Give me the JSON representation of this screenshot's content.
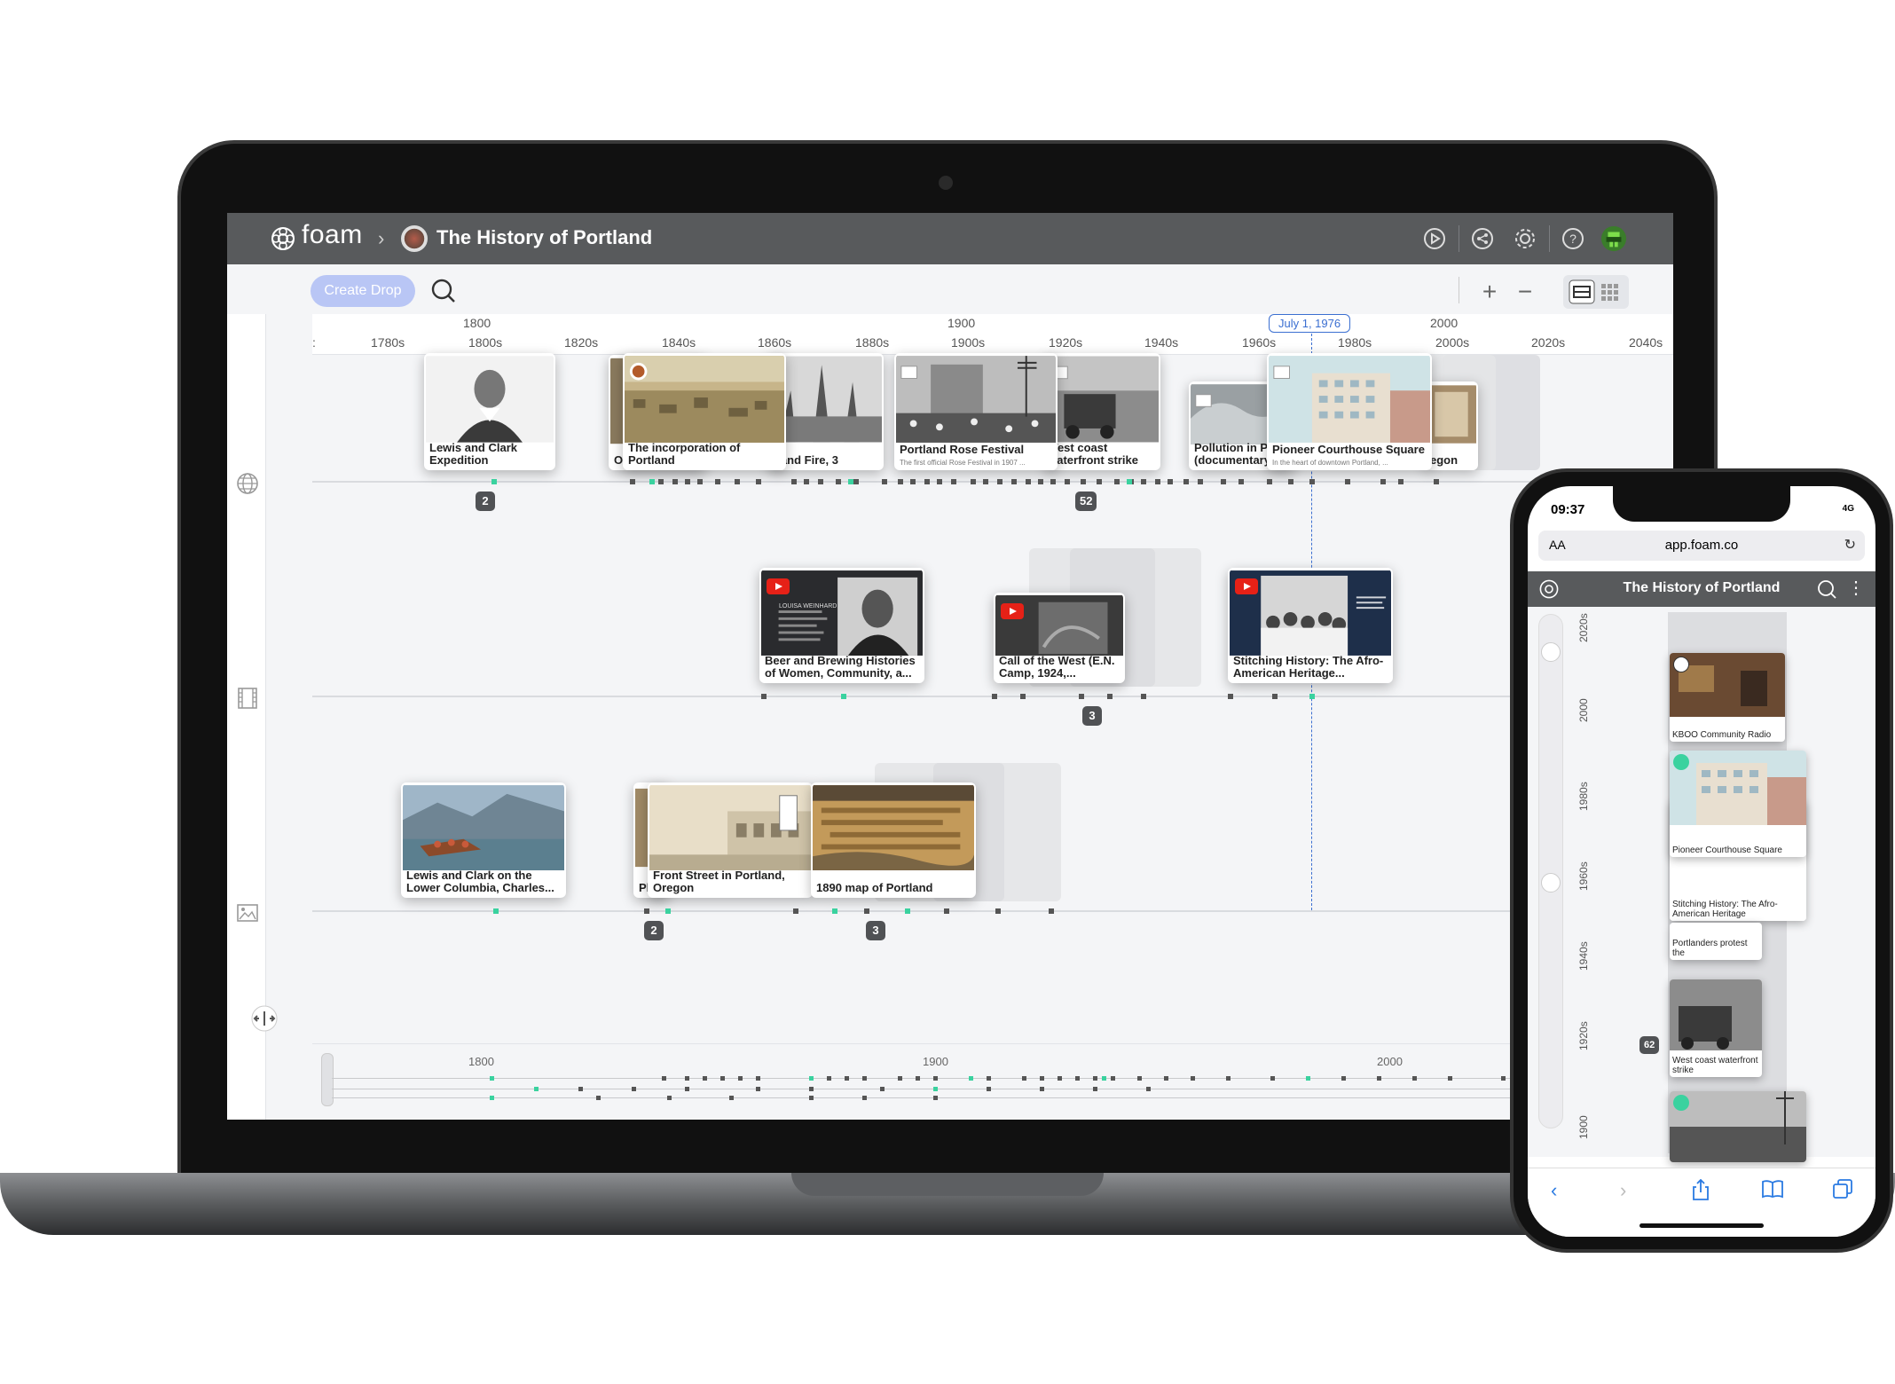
{
  "app": {
    "logo": "foam",
    "breadcrumb_sep": "›",
    "project_title": "The History of Portland",
    "create_drop": "Create Drop",
    "zoom_in": "+",
    "zoom_out": "−"
  },
  "axis": {
    "major": [
      "1800",
      "1900",
      "2000"
    ],
    "minor": [
      ":",
      "1780s",
      "1800s",
      "1820s",
      "1840s",
      "1860s",
      "1880s",
      "1900s",
      "1920s",
      "1940s",
      "1960s",
      "1980s",
      "2000s",
      "2020s",
      "2040s"
    ],
    "selected_date": "July 1, 1976"
  },
  "lanes": {
    "web": {
      "icon": "globe-icon",
      "count": "2",
      "count2": "52",
      "cards": [
        {
          "title": "Lewis and Clark Expedition"
        },
        {
          "title": "The incorporation of Portland"
        },
        {
          "title": "tland Fire, 3"
        },
        {
          "title": "O O"
        },
        {
          "title": "Portland Rose Festival",
          "sub": "The first official Rose Festival in 1907 ..."
        },
        {
          "title": "Vest coast vaterfront strike"
        },
        {
          "title": "Pollution in Pa (documentary"
        },
        {
          "title": "Pioneer Courthouse Square",
          "sub": "In the heart of downtown Portland, ..."
        },
        {
          "title": "egon"
        }
      ]
    },
    "video": {
      "icon": "film-icon",
      "count": "3",
      "cards": [
        {
          "title": "Beer and Brewing Histories of Women, Community, a...",
          "slide": "LOUISA WEINHARD"
        },
        {
          "title": "Call of the West (E.N. Camp, 1924,..."
        },
        {
          "title": "Stitching History: The Afro-American Heritage..."
        }
      ]
    },
    "image": {
      "icon": "image-icon",
      "count": "2",
      "count2": "3",
      "cards": [
        {
          "title": "Lewis and Clark on the Lower Columbia, Charles..."
        },
        {
          "title": "Pl"
        },
        {
          "title": "Front Street in Portland, Oregon"
        },
        {
          "title": "1890 map of Portland"
        }
      ]
    }
  },
  "minimap": {
    "labels": [
      "1800",
      "1900",
      "2000"
    ]
  },
  "phone": {
    "time": "09:37",
    "status": "4G",
    "aa": "AA",
    "url": "app.foam.co",
    "title": "The History of Portland",
    "years": [
      "2020s",
      "2000",
      "1980s",
      "1960s",
      "1940s",
      "1920s",
      "1900"
    ],
    "count": "62",
    "cards": [
      {
        "title": "KBOO Community Radio"
      },
      {
        "title": "Pioneer Courthouse Square"
      },
      {
        "title": "Stitching History: The Afro-American Heritage"
      },
      {
        "title": "Portlanders protest the"
      },
      {
        "title": "West coast waterfront strike"
      }
    ]
  },
  "colors": {
    "accent": "#3ad29f",
    "header": "#585a5c",
    "date": "#3b6fd1",
    "button": "#b9c6f5"
  }
}
